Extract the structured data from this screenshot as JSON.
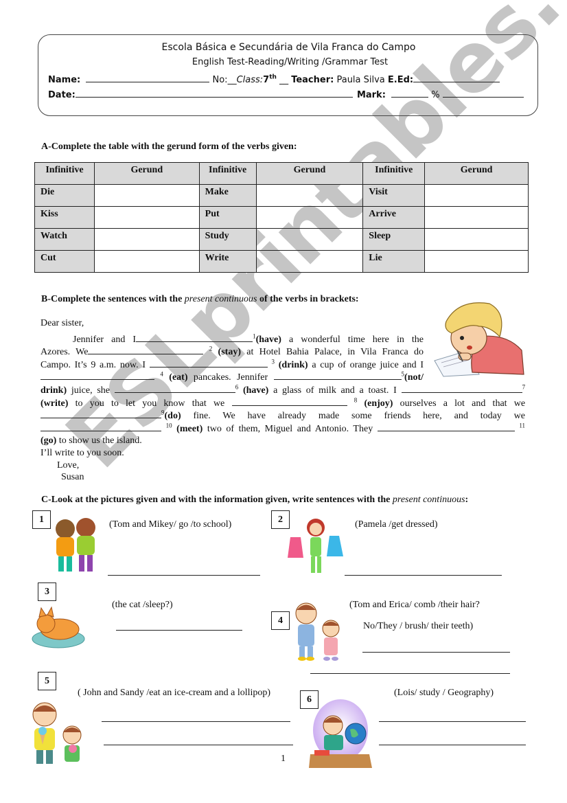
{
  "header": {
    "school": "Escola Básica e Secundária de Vila Franca do Campo",
    "test_name": "English Test-Reading/Writing /Grammar Test",
    "name_label": "Name:",
    "no_label": "No:",
    "no_blank": "__",
    "class_label": "Class:",
    "class_value": "7",
    "class_sup": "th",
    "class_blank": "__",
    "teacher_label": "Teacher:",
    "teacher_value": "Paula Silva",
    "eed_label": "E.Ed:",
    "date_label": "Date:",
    "mark_label": "Mark:",
    "percent_sign": "%"
  },
  "section_a": {
    "title": "A-Complete the table with the gerund form of the verbs given:",
    "headers": [
      "Infinitive",
      "Gerund",
      "Infinitive",
      "Gerund",
      "Infinitive",
      "Gerund"
    ],
    "rows": [
      [
        "Die",
        "",
        "Make",
        "",
        "Visit",
        ""
      ],
      [
        "Kiss",
        "",
        "Put",
        "",
        "Arrive",
        ""
      ],
      [
        "Watch",
        "",
        "Study",
        "",
        "Sleep",
        ""
      ],
      [
        "Cut",
        "",
        "Write",
        "",
        "Lie",
        ""
      ]
    ]
  },
  "section_b": {
    "title_pre": "B-Complete the sentences with the ",
    "title_italic": "present continuous",
    "title_post": " of the verbs in brackets:",
    "greeting": "Dear sister,",
    "text": {
      "l1a": "Jennifer and I",
      "n1": "1",
      "v1": "(have)",
      "l1b": "a wonderful time here in the",
      "l2a": "Azores. We",
      "n2": "2",
      "v2": "(stay)",
      "l2b": "at Hotel Bahia Palace, in Vila Franca do",
      "l3a": "Campo. It’s 9 a.m. now. I",
      "n3": "3",
      "v3": "(drink)",
      "l3b": "a cup of orange juice and I",
      "n4": "4",
      "v4": "(eat)",
      "l4a": "pancakes. Jennifer",
      "n5": "5",
      "v5a": "(not/",
      "v5b": "drink)",
      "l5a": "juice, she",
      "n6": "6",
      "v6": "(have)",
      "l5b": "a glass of milk and a toast. I",
      "n7": "7",
      "v7": "(write)",
      "l6a": "to you to let you know that we",
      "n8": "8",
      "v8": "(enjoy)",
      "l6b": "ourselves a lot and that we",
      "n9": "9",
      "v9": "(do)",
      "l7a": "fine. We have already made some friends here, and today we",
      "n10": "10",
      "v10": "(meet)",
      "l8a": "two of them, Miguel and Antonio. They",
      "n11": "11",
      "v11": "(go)",
      "l9a": "to show us the island."
    },
    "closing1": "I’ll write to you soon.",
    "closing2": "Love,",
    "signature": "Susan"
  },
  "section_c": {
    "title_pre": "C-Look at the pictures given and with the information given, write sentences with the ",
    "title_italic": "present continuous",
    "title_post": ":",
    "items": [
      {
        "number": "1",
        "prompt": "(Tom and Mikey/ go /to school)"
      },
      {
        "number": "2",
        "prompt": "(Pamela /get dressed)"
      },
      {
        "number": "3",
        "prompt": "(the cat /sleep?)"
      },
      {
        "number": "4",
        "prompt": "(Tom and Erica/ comb /their hair?",
        "prompt2": "No/They / brush/ their teeth)"
      },
      {
        "number": "5",
        "prompt": "( John and Sandy /eat an ice-cream and a lollipop)"
      },
      {
        "number": "6",
        "prompt": "(Lois/ study / Geography)"
      }
    ]
  },
  "watermark": "ESLprintables.com",
  "page_number": "1"
}
